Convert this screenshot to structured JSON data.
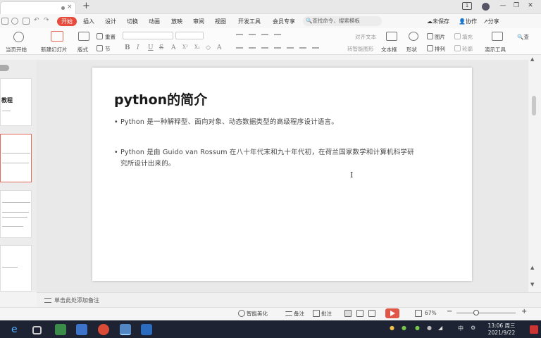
{
  "window": {
    "tab_close_glyph": "×",
    "new_tab_glyph": "+",
    "page_badge": "1",
    "minimize": "—",
    "restore": "❐",
    "close": "✕"
  },
  "menu": {
    "items": [
      "开始",
      "插入",
      "设计",
      "切换",
      "动画",
      "放映",
      "审阅",
      "视图",
      "开发工具",
      "会员专享"
    ],
    "active_index": 0,
    "search_placeholder": "查找命令、搜索模板",
    "right": [
      "未保存",
      "协作",
      "分享"
    ]
  },
  "toolbar": {
    "labels": {
      "play_from_current": "当页开始",
      "new_slide": "新建幻灯片",
      "layout": "版式",
      "section": "节",
      "reset": "重置",
      "text_direction": "对齐文本",
      "smart_graphic": "转智能图形",
      "textbox": "文本框",
      "shape": "形状",
      "picture": "图片",
      "arrange": "排列",
      "fill": "填充",
      "outline": "轮廓",
      "slideshow_tool": "演示工具",
      "find_replace": "查"
    },
    "format_glyphs": [
      "B",
      "I",
      "U",
      "S",
      "A",
      "X²",
      "X₂",
      "◇",
      "A"
    ]
  },
  "sidebar": {
    "thumb1_title": "教程"
  },
  "slide": {
    "title": "python的简介",
    "bullet_glyph": "•",
    "bullets": [
      "Python 是一种解释型、面向对象、动态数据类型的高级程序设计语言。",
      "Python 是由 Guido van Rossum 在八十年代末和九十年代初，在荷兰国家数学和计算机科学研究所设计出来的。"
    ],
    "bullet2_line1": "Python 是由 Guido van Rossum 在八十年代末和九十年代初，在荷兰国家数学和计算机科学研",
    "bullet2_line2": "究所设计出来的。"
  },
  "notes": {
    "placeholder": "单击此处添加备注"
  },
  "statusbar": {
    "beautify": "智能美化",
    "notes": "备注",
    "comments": "批注",
    "zoom": "67%",
    "minus": "−",
    "plus": "+"
  },
  "taskbar": {
    "time": "13:06 周三",
    "date": "2021/9/22",
    "ime": "中"
  },
  "colors": {
    "accent": "#e64b3b",
    "taskbar": "#1d2333",
    "selected_thumb": "#e46a5a"
  }
}
